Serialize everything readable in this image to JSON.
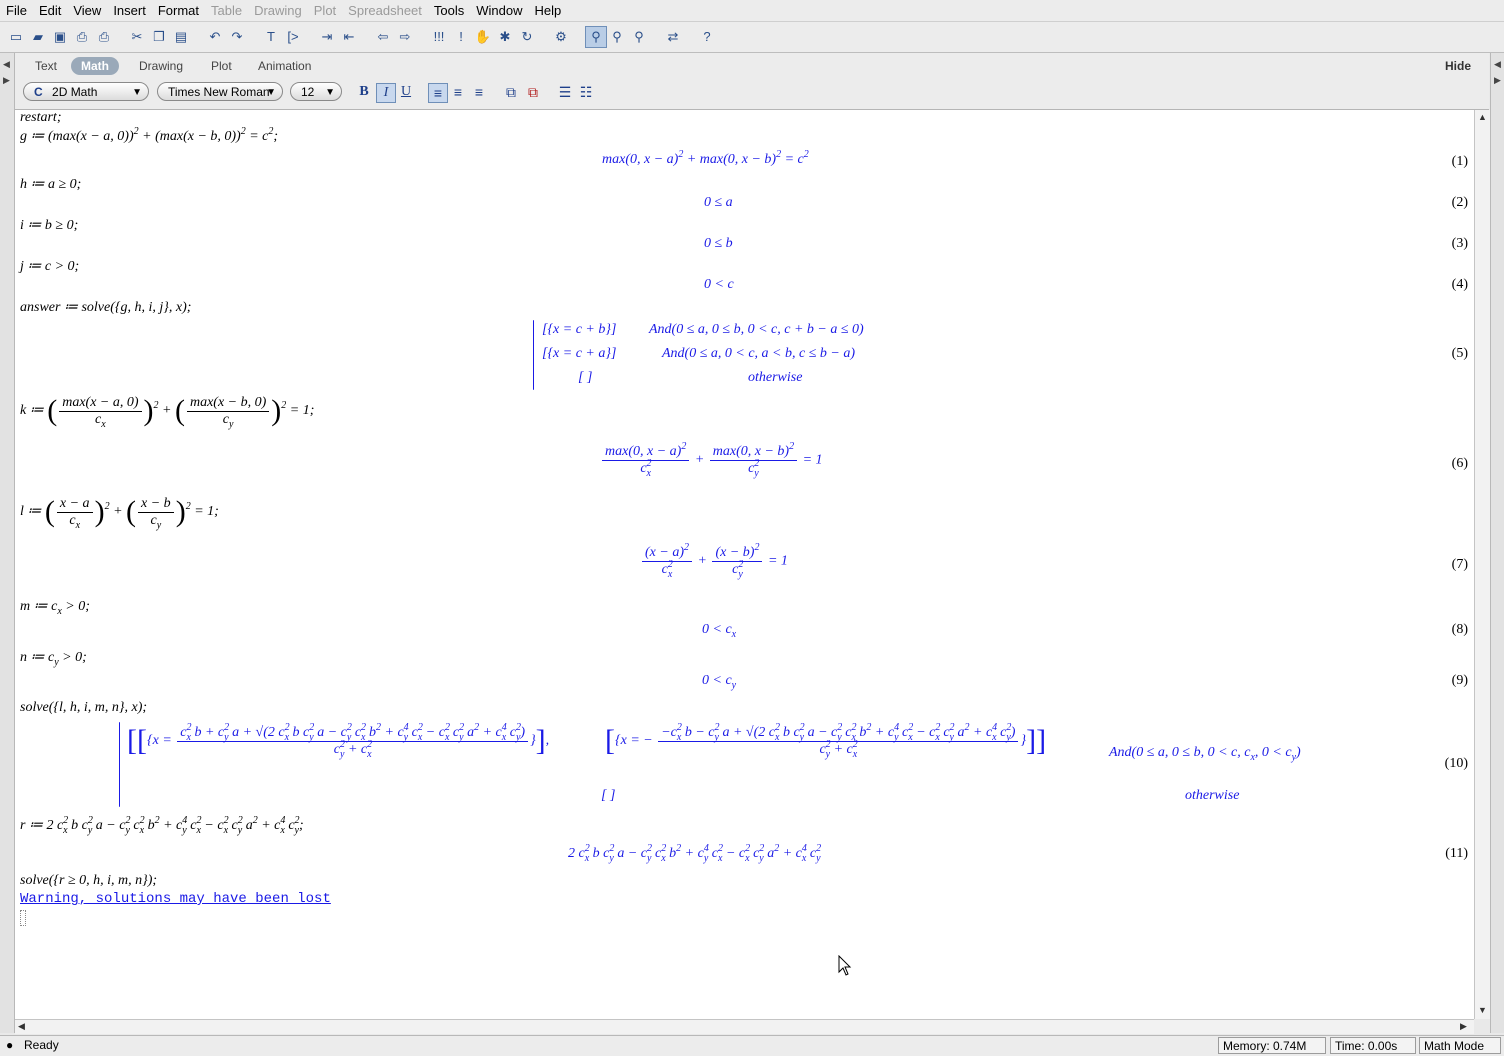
{
  "menu": [
    "File",
    "Edit",
    "View",
    "Insert",
    "Format",
    "Table",
    "Drawing",
    "Plot",
    "Spreadsheet",
    "Tools",
    "Window",
    "Help"
  ],
  "menu_disabled": [
    false,
    false,
    false,
    false,
    false,
    true,
    true,
    true,
    true,
    false,
    false,
    false
  ],
  "context_tabs": [
    "Text",
    "Math",
    "Drawing",
    "Plot",
    "Animation"
  ],
  "active_tab": "Math",
  "hide_label": "Hide",
  "mode_combo": "2D Math",
  "mode_prefix": "C",
  "font_combo": "Times New Roman",
  "size_combo": "12",
  "format_buttons": {
    "bold": "B",
    "italic": "I",
    "underline": "U"
  },
  "inputs": {
    "restart": "restart;",
    "g": "g ≔ (max(x − a, 0))",
    "h": "h ≔ a ≥ 0;",
    "i": "i ≔ b ≥ 0;",
    "j": "j ≔ c > 0;",
    "answer": "answer ≔ solve({g, h, i, j}, x);",
    "k": "k ≔",
    "l": "l ≔",
    "m": "m ≔ c",
    "n": "n ≔ c",
    "solve1": "solve({l, h, i, m, n}, x);",
    "r": "r ≔ 2 c",
    "solve2": "solve({r ≥ 0, h, i, m, n});"
  },
  "outputs": {
    "eq2": "0 ≤ a",
    "eq3": "0 ≤ b",
    "eq4": "0 < c",
    "eq5_rows": [
      {
        "sol": "[{x = c + b}]",
        "cond": "And(0 ≤ a, 0 ≤ b, 0 < c, c + b − a ≤ 0)"
      },
      {
        "sol": "[{x = c + a}]",
        "cond": "And(0 ≤ a, 0 < c, a < b, c ≤ b − a)"
      },
      {
        "sol": "[ ]",
        "cond": "otherwise"
      }
    ],
    "eq10_cond": "And(0 ≤ a, 0 ≤ b, 0 < c",
    "eq10_empty": "[ ]",
    "eq10_otherwise": "otherwise"
  },
  "labels": [
    "(1)",
    "(2)",
    "(3)",
    "(4)",
    "(5)",
    "(6)",
    "(7)",
    "(8)",
    "(9)",
    "(10)",
    "(11)"
  ],
  "warning": "Warning, solutions may have been lost",
  "status": {
    "state": "Ready",
    "memory": "Memory: 0.74M",
    "time": "Time: 0.00s",
    "mode": "Math Mode"
  },
  "colors": {
    "output": "#1a1ae6",
    "tab_active": "#9aa9b9"
  },
  "icons": [
    "new-icon",
    "open-icon",
    "save-icon",
    "print-icon",
    "print-preview-icon",
    "cut-icon",
    "copy-icon",
    "paste-icon",
    "undo-icon",
    "redo-icon",
    "text-icon",
    "prompt-icon",
    "indent-icon",
    "outdent-icon",
    "back-icon",
    "forward-icon",
    "execute-all-icon",
    "execute-icon",
    "stop-icon",
    "debug-icon",
    "restart-icon",
    "settings-icon",
    "zoom-100-icon",
    "zoom-150-icon",
    "zoom-200-icon",
    "swap-icon",
    "help-icon"
  ]
}
